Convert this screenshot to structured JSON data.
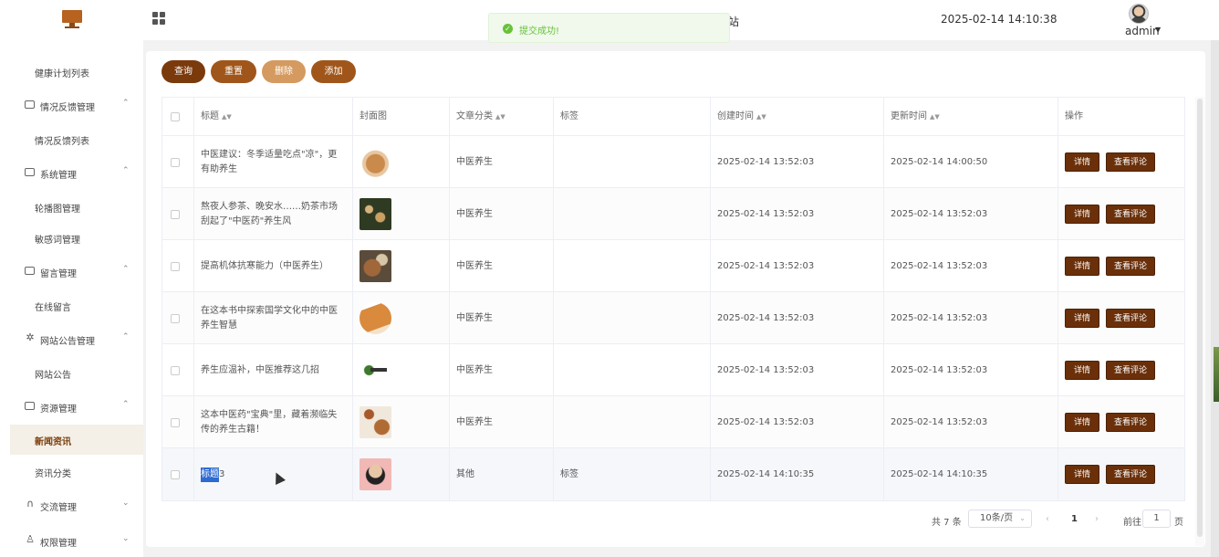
{
  "header": {
    "site_title_fragment": "站",
    "datetime": "2025-02-14 14:10:38",
    "user": "admin"
  },
  "toast": {
    "message": "提交成功!",
    "type": "success"
  },
  "sidebar": {
    "items": [
      {
        "label": "健康计划列表",
        "kind": "sub"
      },
      {
        "label": "情况反馈管理",
        "kind": "group",
        "icon": "feedback-icon",
        "expanded": true
      },
      {
        "label": "情况反馈列表",
        "kind": "sub"
      },
      {
        "label": "系统管理",
        "kind": "group",
        "icon": "system-icon",
        "expanded": true
      },
      {
        "label": "轮播图管理",
        "kind": "sub"
      },
      {
        "label": "敏感词管理",
        "kind": "sub"
      },
      {
        "label": "留言管理",
        "kind": "group",
        "icon": "message-icon",
        "expanded": true
      },
      {
        "label": "在线留言",
        "kind": "sub"
      },
      {
        "label": "网站公告管理",
        "kind": "group",
        "icon": "announcement-icon",
        "expanded": true
      },
      {
        "label": "网站公告",
        "kind": "sub"
      },
      {
        "label": "资源管理",
        "kind": "group",
        "icon": "resource-icon",
        "expanded": true
      },
      {
        "label": "新闻资讯",
        "kind": "sub",
        "active": true
      },
      {
        "label": "资讯分类",
        "kind": "sub"
      },
      {
        "label": "交流管理",
        "kind": "group",
        "icon": "headset-icon",
        "expanded": false
      },
      {
        "label": "权限管理",
        "kind": "group",
        "icon": "user-icon",
        "expanded": false
      }
    ]
  },
  "toolbar": {
    "query": "查询",
    "reset": "重置",
    "delete": "删除",
    "add": "添加"
  },
  "table": {
    "columns": [
      "标题",
      "封面图",
      "文章分类",
      "标签",
      "创建时间",
      "更新时间",
      "操作"
    ],
    "rows": [
      {
        "title": "中医建议：冬季适量吃点\"凉\"，更有助养生",
        "category": "中医养生",
        "tag": "",
        "created": "2025-02-14 13:52:03",
        "updated": "2025-02-14 14:00:50"
      },
      {
        "title": "熬夜人参茶、晚安水……奶茶市场刮起了\"中医药\"养生风",
        "category": "中医养生",
        "tag": "",
        "created": "2025-02-14 13:52:03",
        "updated": "2025-02-14 13:52:03"
      },
      {
        "title": "提高机体抗寒能力（中医养生）",
        "category": "中医养生",
        "tag": "",
        "created": "2025-02-14 13:52:03",
        "updated": "2025-02-14 13:52:03"
      },
      {
        "title": "在这本书中探索国学文化中的中医养生智慧",
        "category": "中医养生",
        "tag": "",
        "created": "2025-02-14 13:52:03",
        "updated": "2025-02-14 13:52:03"
      },
      {
        "title": "养生应温补，中医推荐这几招",
        "category": "中医养生",
        "tag": "",
        "created": "2025-02-14 13:52:03",
        "updated": "2025-02-14 13:52:03"
      },
      {
        "title": "这本中医药\"宝典\"里，藏着濒临失传的养生古籍！",
        "category": "中医养生",
        "tag": "",
        "created": "2025-02-14 13:52:03",
        "updated": "2025-02-14 13:52:03"
      },
      {
        "title_selected": "标题",
        "title_rest": "3",
        "category": "其他",
        "tag": "标签",
        "created": "2025-02-14 14:10:35",
        "updated": "2025-02-14 14:10:35"
      }
    ],
    "actions": {
      "detail": "详情",
      "comments": "查看评论"
    }
  },
  "pagination": {
    "total": "共 7 条",
    "page_size": "10条/页",
    "current": "1",
    "goto_label": "前往",
    "goto_value": "1",
    "page_unit": "页"
  },
  "colors": {
    "primary": "#7b3a0b",
    "accent": "#a0561a",
    "success": "#67c23a"
  }
}
